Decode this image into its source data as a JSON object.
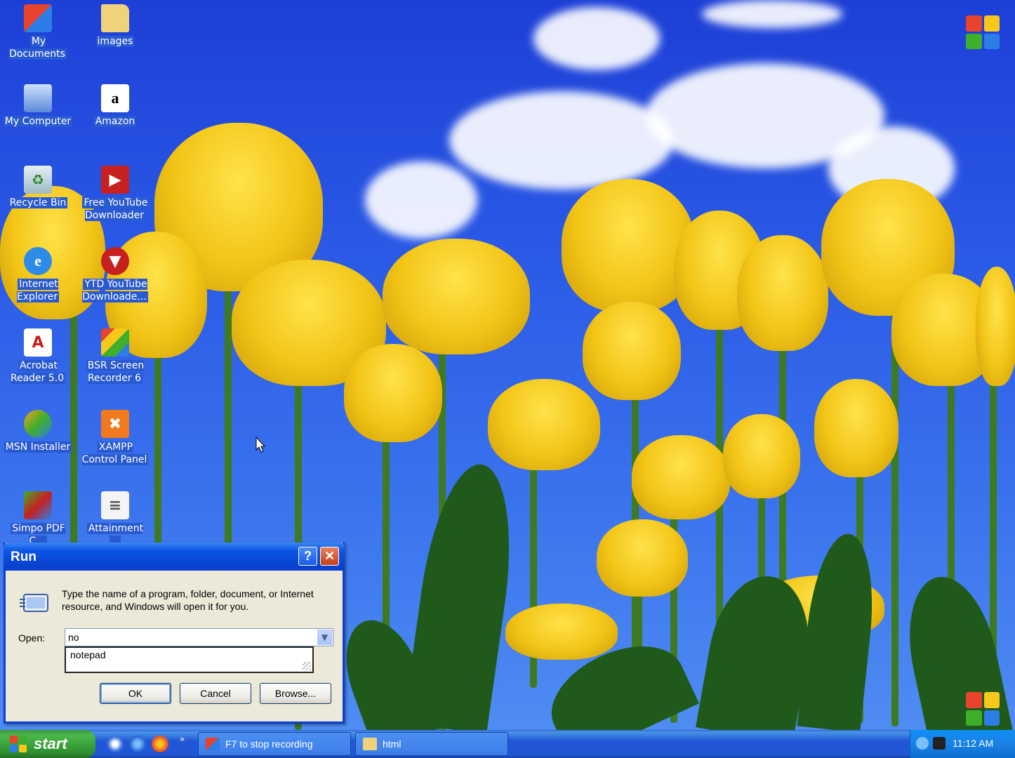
{
  "desktop": {
    "icons": [
      {
        "label": "My Documents",
        "icon": "my-documents-icon"
      },
      {
        "label": "images",
        "icon": "folder-icon"
      },
      {
        "label": "My Computer",
        "icon": "my-computer-icon"
      },
      {
        "label": "Amazon",
        "icon": "amazon-icon"
      },
      {
        "label": "Recycle Bin",
        "icon": "recycle-bin-icon"
      },
      {
        "label": "Free YouTube Downloader",
        "icon": "youtube-downloader-icon"
      },
      {
        "label": "Internet Explorer",
        "icon": "internet-explorer-icon"
      },
      {
        "label": "YTD YouTube Downloade...",
        "icon": "ytd-icon"
      },
      {
        "label": "Acrobat Reader 5.0",
        "icon": "acrobat-icon"
      },
      {
        "label": "BSR Screen Recorder 6",
        "icon": "bsr-recorder-icon"
      },
      {
        "label": "MSN Installer",
        "icon": "msn-icon"
      },
      {
        "label": "XAMPP Control Panel",
        "icon": "xampp-icon"
      },
      {
        "label": "Simpo PDF C...",
        "icon": "simpo-pdf-icon"
      },
      {
        "label": "Attainment ...",
        "icon": "attainment-icon"
      }
    ]
  },
  "run_dialog": {
    "title": "Run",
    "help_label": "?",
    "close_label": "✕",
    "description": "Type the name of a program, folder, document, or Internet resource, and Windows will open it for you.",
    "open_label": "Open:",
    "open_value": "no",
    "autocomplete": [
      "notepad"
    ],
    "ok_label": "OK",
    "cancel_label": "Cancel",
    "browse_label": "Browse..."
  },
  "taskbar": {
    "start_label": "start",
    "tasks": [
      {
        "label": "F7 to stop recording",
        "icon": "recorder-icon"
      },
      {
        "label": "html",
        "icon": "folder-icon"
      }
    ],
    "clock": "11:12 AM"
  },
  "colors": {
    "xp_red": "#e8432c",
    "xp_green": "#3fae2a",
    "xp_blue": "#2c7de8",
    "xp_yellow": "#f8c71c",
    "title_blue": "#0a3fcf",
    "taskbar_blue": "#2157d7",
    "start_green": "#3c9a3c"
  }
}
